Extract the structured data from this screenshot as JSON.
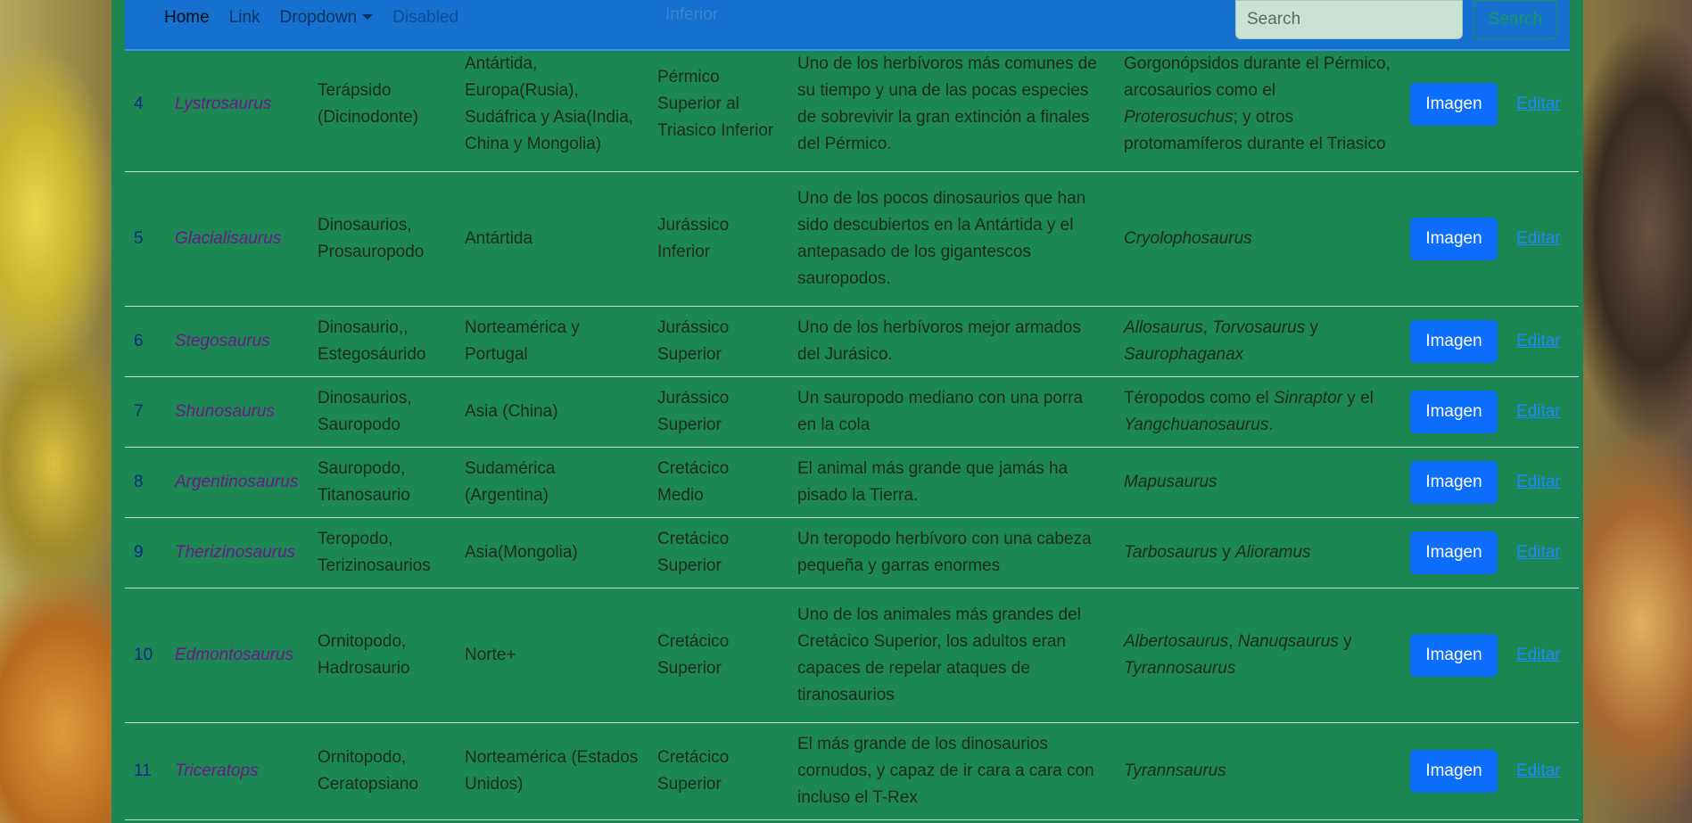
{
  "nav": {
    "home": "Home",
    "link": "Link",
    "dropdown": "Dropdown",
    "disabled": "Disabled",
    "ghost": "Inferior",
    "search_placeholder": "Search",
    "search_button": "Search"
  },
  "rows": [
    {
      "id": "4",
      "name": "Lystrosaurus",
      "type": "Terápsido (Dicinodonte)",
      "region": "Antártida, Europa(Rusia), Sudáfrica y Asia(India, China y Mongolia)",
      "period": "Pérmico Superior al Triasico Inferior",
      "desc": "Uno de los herbívoros más comunes de su tiempo y una de las pocas especies de sobrevivir la gran extinción a finales del Pérmico.",
      "pred": [
        {
          "t": "Gorgonópsidos durante el Pérmico, arcosaurios como el ",
          "i": false
        },
        {
          "t": "Proterosuchus",
          "i": true
        },
        {
          "t": "; y otros protomamíferos durante el Triasico",
          "i": false
        }
      ],
      "image_btn": "Imagen",
      "edit": "Editar"
    },
    {
      "id": "5",
      "name": "Glacialisaurus",
      "type": "Dinosaurios, Prosauropodo",
      "region": "Antártida",
      "period": "Jurássico Inferior",
      "desc": "Uno de los pocos dinosaurios que han sido descubiertos en la Antártida y el antepasado de los gigantescos sauropodos.",
      "pred": [
        {
          "t": "Cryolophosaurus",
          "i": true
        }
      ],
      "image_btn": "Imagen",
      "edit": "Editar"
    },
    {
      "id": "6",
      "name": "Stegosaurus",
      "type": "Dinosaurio,, Estegosáurido",
      "region": "Norteamérica y Portugal",
      "period": "Jurássico Superior",
      "desc": "Uno de los herbívoros mejor armados del Jurásico.",
      "pred": [
        {
          "t": "Allosaurus",
          "i": true
        },
        {
          "t": ", ",
          "i": false
        },
        {
          "t": "Torvosaurus",
          "i": true
        },
        {
          "t": " y ",
          "i": false
        },
        {
          "t": "Saurophaganax",
          "i": true
        }
      ],
      "image_btn": "Imagen",
      "edit": "Editar"
    },
    {
      "id": "7",
      "name": "Shunosaurus",
      "type": "Dinosaurios, Sauropodo",
      "region": "Asia (China)",
      "period": "Jurássico Superior",
      "desc": "Un sauropodo mediano con una porra en la cola",
      "pred": [
        {
          "t": "Téropodos como el ",
          "i": false
        },
        {
          "t": "Sinraptor",
          "i": true
        },
        {
          "t": " y el ",
          "i": false
        },
        {
          "t": "Yangchuanosaurus",
          "i": true
        },
        {
          "t": ".",
          "i": false
        }
      ],
      "image_btn": "Imagen",
      "edit": "Editar"
    },
    {
      "id": "8",
      "name": "Argentinosaurus",
      "type": "Sauropodo, Titanosaurio",
      "region": "Sudamérica (Argentina)",
      "period": "Cretácico Medio",
      "desc": "El animal más grande que jamás ha pisado la Tierra.",
      "pred": [
        {
          "t": "Mapusaurus",
          "i": true
        }
      ],
      "image_btn": "Imagen",
      "edit": "Editar"
    },
    {
      "id": "9",
      "name": "Therizinosaurus",
      "type": "Teropodo, Terizinosaurios",
      "region": "Asia(Mongolia)",
      "period": "Cretácico Superior",
      "desc": "Un teropodo herbívoro con una cabeza pequeña y garras enormes",
      "pred": [
        {
          "t": "Tarbosaurus",
          "i": true
        },
        {
          "t": " y ",
          "i": false
        },
        {
          "t": "Alioramus",
          "i": true
        }
      ],
      "image_btn": "Imagen",
      "edit": "Editar"
    },
    {
      "id": "10",
      "name": "Edmontosaurus",
      "type": "Ornitopodo, Hadrosaurio",
      "region": "Norte+",
      "period": "Cretácico Superior",
      "desc": "Uno de los animales más grandes del Cretácico Superior, los adultos eran capaces de repelar ataques de tiranosaurios",
      "pred": [
        {
          "t": "Albertosaurus",
          "i": true
        },
        {
          "t": ", ",
          "i": false
        },
        {
          "t": "Nanuqsaurus",
          "i": true
        },
        {
          "t": " y ",
          "i": false
        },
        {
          "t": "Tyrannosaurus",
          "i": true
        }
      ],
      "image_btn": "Imagen",
      "edit": "Editar"
    },
    {
      "id": "11",
      "name": "Triceratops",
      "type": "Ornitopodo, Ceratopsiano",
      "region": "Norteamérica (Estados Unidos)",
      "period": "Cretácico Superior",
      "desc": "El más grande de los dinosaurios cornudos, y capaz de ir cara a cara con incluso el T-Rex",
      "pred": [
        {
          "t": "Tyrannsaurus",
          "i": true
        }
      ],
      "image_btn": "Imagen",
      "edit": "Editar"
    }
  ]
}
